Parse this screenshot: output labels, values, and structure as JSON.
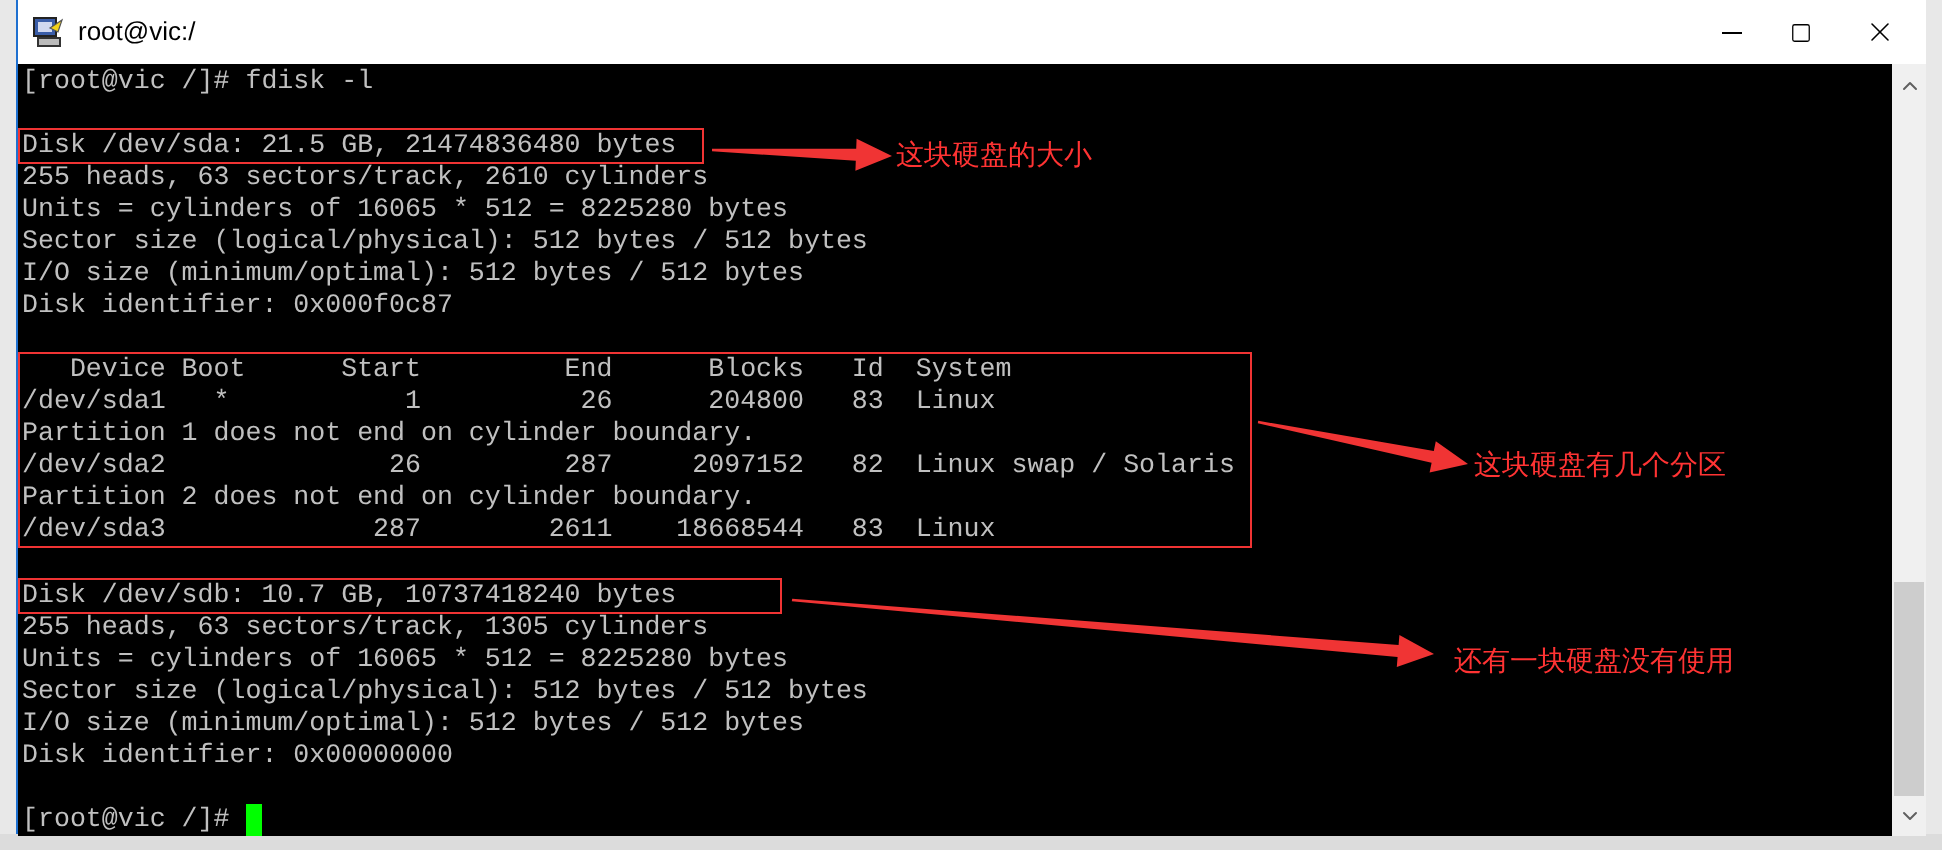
{
  "window": {
    "title": "root@vic:/"
  },
  "terminal": {
    "blocks": [
      {
        "lines": [
          "[root@vic /]# fdisk -l"
        ]
      },
      {
        "lines": [
          "Disk /dev/sda: 21.5 GB, 21474836480 bytes",
          "255 heads, 63 sectors/track, 2610 cylinders",
          "Units = cylinders of 16065 * 512 = 8225280 bytes",
          "Sector size (logical/physical): 512 bytes / 512 bytes",
          "I/O size (minimum/optimal): 512 bytes / 512 bytes",
          "Disk identifier: 0x000f0c87"
        ]
      },
      {
        "lines": [
          "   Device Boot      Start         End      Blocks   Id  System",
          "/dev/sda1   *           1          26      204800   83  Linux",
          "Partition 1 does not end on cylinder boundary.",
          "/dev/sda2              26         287     2097152   82  Linux swap / Solaris",
          "Partition 2 does not end on cylinder boundary.",
          "/dev/sda3             287        2611    18668544   83  Linux"
        ]
      },
      {
        "lines": [
          "Disk /dev/sdb: 10.7 GB, 10737418240 bytes",
          "255 heads, 63 sectors/track, 1305 cylinders",
          "Units = cylinders of 16065 * 512 = 8225280 bytes",
          "Sector size (logical/physical): 512 bytes / 512 bytes",
          "I/O size (minimum/optimal): 512 bytes / 512 bytes",
          "Disk identifier: 0x00000000"
        ]
      },
      {
        "lines": [
          "[root@vic /]# "
        ]
      }
    ],
    "cursor_visible": true
  },
  "annotations": [
    {
      "label": "这块硬盘的大小"
    },
    {
      "label": "这块硬盘有几个分区"
    },
    {
      "label": "还有一块硬盘没有使用"
    }
  ]
}
